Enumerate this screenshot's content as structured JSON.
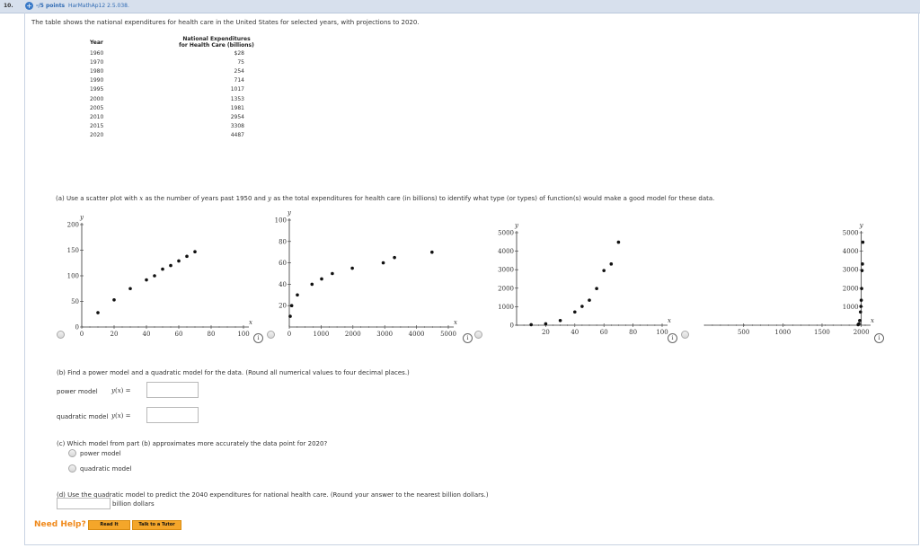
{
  "header": {
    "qnum": "10.",
    "plus": "+",
    "points": "-/5 points",
    "problem_id": "HarMathAp12 2.5.038."
  },
  "intro": "The table shows the national expenditures for health care in the United States for selected years, with projections to 2020.",
  "table": {
    "col1": "Year",
    "col2_line1": "National Expenditures",
    "col2_line2": "for Health Care (billions)",
    "rows": [
      [
        "1960",
        "$28"
      ],
      [
        "1970",
        "75"
      ],
      [
        "1980",
        "254"
      ],
      [
        "1990",
        "714"
      ],
      [
        "1995",
        "1017"
      ],
      [
        "2000",
        "1353"
      ],
      [
        "2005",
        "1981"
      ],
      [
        "2010",
        "2954"
      ],
      [
        "2015",
        "3308"
      ],
      [
        "2020",
        "4487"
      ]
    ]
  },
  "part_a": {
    "pre": "(a) Use a scatter plot with ",
    "xvar": "x",
    "mid": " as the number of years past 1950 and ",
    "yvar": "y",
    "post": " as the total expenditures for health care (in billions) to identify what type (or types) of function(s) would make a good model for these data."
  },
  "info_glyph": "i",
  "chart_data": [
    {
      "type": "scatter",
      "xlabel": "x",
      "ylabel": "y",
      "xlim": [
        0,
        100
      ],
      "ylim": [
        0,
        200
      ],
      "xticks": [
        "0",
        "20",
        "40",
        "60",
        "80",
        "100"
      ],
      "yticks": [
        "0",
        "50",
        "100",
        "150",
        "200"
      ],
      "x": [
        10,
        20,
        30,
        40,
        45,
        50,
        55,
        60,
        65,
        70
      ],
      "y": [
        28,
        53,
        75,
        92,
        100,
        113,
        120,
        129,
        138,
        147
      ]
    },
    {
      "type": "scatter",
      "xlabel": "x",
      "ylabel": "y",
      "xlim": [
        0,
        5000
      ],
      "ylim": [
        0,
        100
      ],
      "xticks": [
        "0",
        "1000",
        "2000",
        "3000",
        "4000",
        "5000"
      ],
      "yticks": [
        "20",
        "40",
        "60",
        "80",
        "100"
      ],
      "x": [
        28,
        75,
        254,
        714,
        1017,
        1353,
        1981,
        2954,
        3308,
        4487
      ],
      "y": [
        10,
        20,
        30,
        40,
        45,
        50,
        55,
        60,
        65,
        70
      ]
    },
    {
      "type": "scatter",
      "xlabel": "x",
      "ylabel": "y",
      "xlim": [
        0,
        100
      ],
      "ylim": [
        0,
        5000
      ],
      "xticks": [
        "20",
        "40",
        "60",
        "80",
        "100"
      ],
      "yticks": [
        "0",
        "1000",
        "2000",
        "3000",
        "4000",
        "5000"
      ],
      "x": [
        10,
        20,
        30,
        40,
        45,
        50,
        55,
        60,
        65,
        70
      ],
      "y": [
        28,
        75,
        254,
        714,
        1017,
        1353,
        1981,
        2954,
        3308,
        4487
      ]
    },
    {
      "type": "scatter",
      "xlabel": "x",
      "ylabel": "y",
      "xlim": [
        0,
        2050
      ],
      "ylim": [
        0,
        5000
      ],
      "xticks": [
        "500",
        "1000",
        "1500",
        "2000"
      ],
      "yticks": [
        "1000",
        "2000",
        "3000",
        "4000",
        "5000"
      ],
      "x": [
        1960,
        1970,
        1980,
        1990,
        1995,
        2000,
        2005,
        2010,
        2015,
        2020
      ],
      "y": [
        28,
        75,
        254,
        714,
        1017,
        1353,
        1981,
        2954,
        3308,
        4487
      ]
    }
  ],
  "part_b": {
    "prompt": "(b) Find a power model and a quadratic model for the data. (Round all numerical values to four decimal places.)",
    "power_label": "power model",
    "quad_label": "quadratic model",
    "fx_y": "y",
    "fx_open": "(",
    "fx_x": "x",
    "fx_close": ") =",
    "power_value": "",
    "quad_value": ""
  },
  "part_c": {
    "prompt": "(c) Which model from part (b) approximates more accurately the data point for 2020?",
    "options": [
      "power model",
      "quadratic model"
    ]
  },
  "part_d": {
    "prompt": "(d) Use the quadratic model to predict the 2040 expenditures for national health care. (Round your answer to the nearest billion dollars.)",
    "unit": "billion dollars",
    "value": ""
  },
  "help": {
    "label": "Need Help?",
    "read": "Read It",
    "talk": "Talk to a Tutor"
  },
  "colors": {
    "accent": "#f4a62a",
    "help": "#f08a1c",
    "header": "#d7e0ed",
    "points_link": "#2f6ab3"
  }
}
